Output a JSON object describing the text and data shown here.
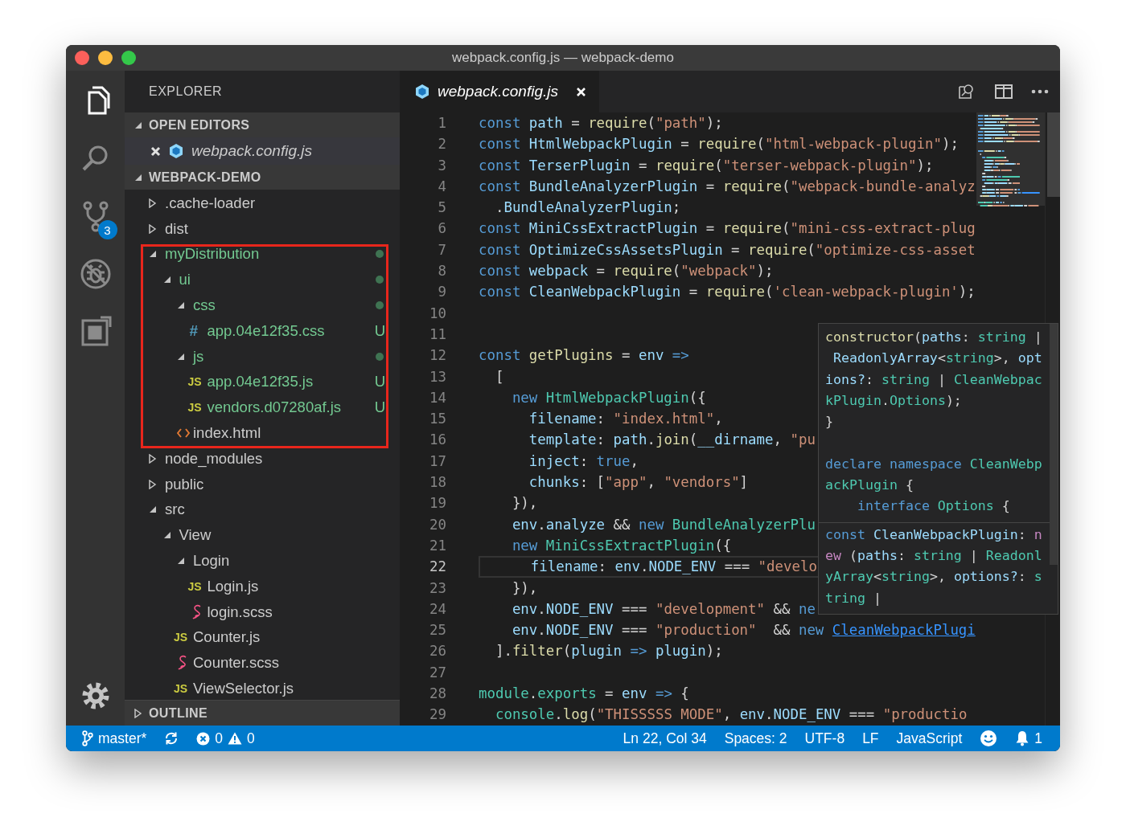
{
  "window": {
    "title": "webpack.config.js — webpack-demo"
  },
  "activity_bar": {
    "items": [
      {
        "kind": "explorer",
        "selected": true
      },
      {
        "kind": "search",
        "selected": false
      },
      {
        "kind": "source_control",
        "selected": false,
        "badge": "3"
      },
      {
        "kind": "debug",
        "selected": false
      },
      {
        "kind": "extensions",
        "selected": false
      }
    ]
  },
  "sidebar": {
    "title": "EXPLORER",
    "open_editors": {
      "title": "OPEN EDITORS",
      "expanded": true,
      "items": [
        {
          "name": "webpack.config.js",
          "selected": true
        }
      ]
    },
    "project": {
      "title": "WEBPACK-DEMO",
      "expanded": true,
      "tree": [
        {
          "name": ".cache-loader",
          "kind": "folder",
          "expanded": false,
          "untracked": false,
          "annotated": false
        },
        {
          "name": "dist",
          "kind": "folder",
          "expanded": false,
          "untracked": false,
          "annotated": false
        },
        {
          "name": "myDistribution",
          "kind": "folder",
          "expanded": true,
          "untracked": true,
          "annotated": true,
          "children": [
            {
              "name": "ui",
              "kind": "folder",
              "expanded": true,
              "untracked": true,
              "children": [
                {
                  "name": "css",
                  "kind": "folder",
                  "expanded": true,
                  "untracked": true,
                  "children": [
                    {
                      "name": "app.04e12f35.css",
                      "kind": "css",
                      "glyph": "#",
                      "untracked": true,
                      "badge": "U"
                    }
                  ]
                },
                {
                  "name": "js",
                  "kind": "folder",
                  "expanded": true,
                  "untracked": true,
                  "children": [
                    {
                      "name": "app.04e12f35.js",
                      "kind": "js",
                      "glyph": "JS",
                      "untracked": true,
                      "badge": "U"
                    },
                    {
                      "name": "vendors.d07280af.js",
                      "kind": "js",
                      "glyph": "JS",
                      "untracked": true,
                      "badge": "U"
                    }
                  ]
                },
                {
                  "name": "index.html",
                  "kind": "html",
                  "untracked": false
                }
              ]
            }
          ]
        },
        {
          "name": "node_modules",
          "kind": "folder",
          "expanded": false,
          "untracked": false,
          "annotated": false
        },
        {
          "name": "public",
          "kind": "folder",
          "expanded": false,
          "untracked": false,
          "annotated": false
        },
        {
          "name": "src",
          "kind": "folder",
          "expanded": true,
          "untracked": false,
          "annotated": false,
          "children": [
            {
              "name": "View",
              "kind": "folder",
              "expanded": true,
              "untracked": false,
              "children": [
                {
                  "name": "Login",
                  "kind": "folder",
                  "expanded": true,
                  "untracked": false,
                  "children": [
                    {
                      "name": "Login.js",
                      "kind": "js",
                      "glyph": "JS",
                      "untracked": false
                    },
                    {
                      "name": "login.scss",
                      "kind": "scss",
                      "untracked": false
                    }
                  ]
                },
                {
                  "name": "Counter.js",
                  "kind": "js",
                  "glyph": "JS",
                  "untracked": false
                },
                {
                  "name": "Counter.scss",
                  "kind": "scss",
                  "untracked": false
                },
                {
                  "name": "ViewSelector.js",
                  "kind": "js",
                  "glyph": "JS",
                  "untracked": false
                }
              ]
            }
          ]
        }
      ]
    },
    "outline": {
      "title": "OUTLINE",
      "expanded": false
    }
  },
  "editor": {
    "tabs": [
      {
        "label": "webpack.config.js",
        "selected": true
      }
    ],
    "lines": [
      {
        "number": "1",
        "current": false,
        "tokens": [
          {
            "kind": "keyword",
            "text": "const"
          },
          {
            "kind": "variable",
            "text": " path"
          },
          {
            "kind": "plain",
            "text": " = "
          },
          {
            "kind": "function",
            "text": "require"
          },
          {
            "kind": "plain",
            "text": "("
          },
          {
            "kind": "string",
            "text": "\"path\""
          },
          {
            "kind": "plain",
            "text": ");"
          }
        ]
      },
      {
        "number": "2",
        "current": false,
        "tokens": [
          {
            "kind": "keyword",
            "text": "const"
          },
          {
            "kind": "variable",
            "text": " HtmlWebpackPlugin"
          },
          {
            "kind": "plain",
            "text": " = "
          },
          {
            "kind": "function",
            "text": "require"
          },
          {
            "kind": "plain",
            "text": "("
          },
          {
            "kind": "string",
            "text": "\"html-webpack-plugin\""
          },
          {
            "kind": "plain",
            "text": ");"
          }
        ]
      },
      {
        "number": "3",
        "current": false,
        "tokens": [
          {
            "kind": "keyword",
            "text": "const"
          },
          {
            "kind": "variable",
            "text": " TerserPlugin"
          },
          {
            "kind": "plain",
            "text": " = "
          },
          {
            "kind": "function",
            "text": "require"
          },
          {
            "kind": "plain",
            "text": "("
          },
          {
            "kind": "string",
            "text": "\"terser-webpack-plugin\""
          },
          {
            "kind": "plain",
            "text": ");"
          }
        ]
      },
      {
        "number": "4",
        "current": false,
        "tokens": [
          {
            "kind": "keyword",
            "text": "const"
          },
          {
            "kind": "variable",
            "text": " BundleAnalyzerPlugin"
          },
          {
            "kind": "plain",
            "text": " = "
          },
          {
            "kind": "function",
            "text": "require"
          },
          {
            "kind": "plain",
            "text": "("
          },
          {
            "kind": "string",
            "text": "\"webpack-bundle-analyz"
          }
        ]
      },
      {
        "number": "5",
        "current": false,
        "tokens": [
          {
            "kind": "plain",
            "text": "  ."
          },
          {
            "kind": "variable",
            "text": "BundleAnalyzerPlugin"
          },
          {
            "kind": "plain",
            "text": ";"
          }
        ]
      },
      {
        "number": "6",
        "current": false,
        "tokens": [
          {
            "kind": "keyword",
            "text": "const"
          },
          {
            "kind": "variable",
            "text": " MiniCssExtractPlugin"
          },
          {
            "kind": "plain",
            "text": " = "
          },
          {
            "kind": "function",
            "text": "require"
          },
          {
            "kind": "plain",
            "text": "("
          },
          {
            "kind": "string",
            "text": "\"mini-css-extract-plug"
          }
        ]
      },
      {
        "number": "7",
        "current": false,
        "tokens": [
          {
            "kind": "keyword",
            "text": "const"
          },
          {
            "kind": "variable",
            "text": " OptimizeCssAssetsPlugin"
          },
          {
            "kind": "plain",
            "text": " = "
          },
          {
            "kind": "function",
            "text": "require"
          },
          {
            "kind": "plain",
            "text": "("
          },
          {
            "kind": "string",
            "text": "\"optimize-css-asset"
          }
        ]
      },
      {
        "number": "8",
        "current": false,
        "tokens": [
          {
            "kind": "keyword",
            "text": "const"
          },
          {
            "kind": "variable",
            "text": " webpack"
          },
          {
            "kind": "plain",
            "text": " = "
          },
          {
            "kind": "function",
            "text": "require"
          },
          {
            "kind": "plain",
            "text": "("
          },
          {
            "kind": "string",
            "text": "\"webpack\""
          },
          {
            "kind": "plain",
            "text": ");"
          }
        ]
      },
      {
        "number": "9",
        "current": false,
        "tokens": [
          {
            "kind": "keyword",
            "text": "const"
          },
          {
            "kind": "variable",
            "text": " CleanWebpackPlugin"
          },
          {
            "kind": "plain",
            "text": " = "
          },
          {
            "kind": "function",
            "text": "require"
          },
          {
            "kind": "plain",
            "text": "("
          },
          {
            "kind": "string",
            "text": "'clean-webpack-plugin'"
          },
          {
            "kind": "plain",
            "text": ");"
          }
        ]
      },
      {
        "number": "10",
        "current": false
      },
      {
        "number": "11",
        "current": false
      },
      {
        "number": "12",
        "current": false,
        "tokens": [
          {
            "kind": "keyword",
            "text": "const"
          },
          {
            "kind": "function",
            "text": " getPlugins"
          },
          {
            "kind": "plain",
            "text": " = "
          },
          {
            "kind": "variable",
            "text": "env"
          },
          {
            "kind": "keyword",
            "text": " =>"
          }
        ]
      },
      {
        "number": "13",
        "current": false,
        "tokens": [
          {
            "kind": "plain",
            "text": "  ["
          }
        ]
      },
      {
        "number": "14",
        "current": false,
        "tokens": [
          {
            "kind": "keyword",
            "text": "    new"
          },
          {
            "kind": "class",
            "text": " HtmlWebpackPlugin"
          },
          {
            "kind": "plain",
            "text": "({"
          }
        ]
      },
      {
        "number": "15",
        "current": false,
        "tokens": [
          {
            "kind": "variable",
            "text": "      filename"
          },
          {
            "kind": "plain",
            "text": ": "
          },
          {
            "kind": "string",
            "text": "\"index.html\""
          },
          {
            "kind": "plain",
            "text": ","
          }
        ]
      },
      {
        "number": "16",
        "current": false,
        "tokens": [
          {
            "kind": "variable",
            "text": "      template"
          },
          {
            "kind": "plain",
            "text": ": "
          },
          {
            "kind": "variable",
            "text": "path"
          },
          {
            "kind": "plain",
            "text": "."
          },
          {
            "kind": "function",
            "text": "join"
          },
          {
            "kind": "plain",
            "text": "("
          },
          {
            "kind": "variable",
            "text": "__dirname"
          },
          {
            "kind": "plain",
            "text": ", "
          },
          {
            "kind": "string",
            "text": "\"pu"
          }
        ]
      },
      {
        "number": "17",
        "current": false,
        "tokens": [
          {
            "kind": "variable",
            "text": "      inject"
          },
          {
            "kind": "plain",
            "text": ": "
          },
          {
            "kind": "keyword",
            "text": "true"
          },
          {
            "kind": "plain",
            "text": ","
          }
        ]
      },
      {
        "number": "18",
        "current": false,
        "tokens": [
          {
            "kind": "variable",
            "text": "      chunks"
          },
          {
            "kind": "plain",
            "text": ": ["
          },
          {
            "kind": "string",
            "text": "\"app\""
          },
          {
            "kind": "plain",
            "text": ", "
          },
          {
            "kind": "string",
            "text": "\"vendors\""
          },
          {
            "kind": "plain",
            "text": "]"
          }
        ]
      },
      {
        "number": "19",
        "current": false,
        "tokens": [
          {
            "kind": "plain",
            "text": "    }),"
          }
        ]
      },
      {
        "number": "20",
        "current": false,
        "tokens": [
          {
            "kind": "variable",
            "text": "    env"
          },
          {
            "kind": "plain",
            "text": "."
          },
          {
            "kind": "variable",
            "text": "analyze"
          },
          {
            "kind": "plain",
            "text": " && "
          },
          {
            "kind": "keyword",
            "text": "new"
          },
          {
            "kind": "class",
            "text": " BundleAnalyzerPlu"
          }
        ]
      },
      {
        "number": "21",
        "current": false,
        "tokens": [
          {
            "kind": "keyword",
            "text": "    new"
          },
          {
            "kind": "class",
            "text": " MiniCssExtractPlugin"
          },
          {
            "kind": "plain",
            "text": "({"
          }
        ]
      },
      {
        "number": "22",
        "current": true,
        "tokens": [
          {
            "kind": "variable",
            "text": "      filename"
          },
          {
            "kind": "plain",
            "text": ": "
          },
          {
            "kind": "variable",
            "text": "env"
          },
          {
            "kind": "plain",
            "text": "."
          },
          {
            "kind": "variable",
            "text": "NODE_ENV"
          },
          {
            "kind": "plain",
            "text": " === "
          },
          {
            "kind": "string",
            "text": "\"develo"
          }
        ]
      },
      {
        "number": "23",
        "current": false,
        "tokens": [
          {
            "kind": "plain",
            "text": "    }),"
          }
        ]
      },
      {
        "number": "24",
        "current": false,
        "tokens": [
          {
            "kind": "variable",
            "text": "    env"
          },
          {
            "kind": "plain",
            "text": "."
          },
          {
            "kind": "variable",
            "text": "NODE_ENV"
          },
          {
            "kind": "plain",
            "text": " === "
          },
          {
            "kind": "string",
            "text": "\"development\""
          },
          {
            "kind": "plain",
            "text": " && "
          },
          {
            "kind": "keyword",
            "text": "ne"
          }
        ]
      },
      {
        "number": "25",
        "current": false,
        "tokens": [
          {
            "kind": "variable",
            "text": "    env"
          },
          {
            "kind": "plain",
            "text": "."
          },
          {
            "kind": "variable",
            "text": "NODE_ENV"
          },
          {
            "kind": "plain",
            "text": " === "
          },
          {
            "kind": "string",
            "text": "\"production\""
          },
          {
            "kind": "plain",
            "text": "  && "
          },
          {
            "kind": "keyword",
            "text": "new "
          },
          {
            "kind": "link",
            "text": "CleanWebpackPlugi"
          }
        ]
      },
      {
        "number": "26",
        "current": false,
        "tokens": [
          {
            "kind": "plain",
            "text": "  ]."
          },
          {
            "kind": "function",
            "text": "filter"
          },
          {
            "kind": "plain",
            "text": "("
          },
          {
            "kind": "variable",
            "text": "plugin"
          },
          {
            "kind": "keyword",
            "text": " =>"
          },
          {
            "kind": "variable",
            "text": " plugin"
          },
          {
            "kind": "plain",
            "text": ");"
          }
        ]
      },
      {
        "number": "27",
        "current": false
      },
      {
        "number": "28",
        "current": false,
        "tokens": [
          {
            "kind": "class",
            "text": "module"
          },
          {
            "kind": "plain",
            "text": "."
          },
          {
            "kind": "class",
            "text": "exports"
          },
          {
            "kind": "plain",
            "text": " = "
          },
          {
            "kind": "variable",
            "text": "env"
          },
          {
            "kind": "keyword",
            "text": " =>"
          },
          {
            "kind": "plain",
            "text": " {"
          }
        ]
      },
      {
        "number": "29",
        "current": false,
        "tokens": [
          {
            "kind": "class",
            "text": "  console"
          },
          {
            "kind": "plain",
            "text": "."
          },
          {
            "kind": "function",
            "text": "log"
          },
          {
            "kind": "plain",
            "text": "("
          },
          {
            "kind": "string",
            "text": "\"THISSSSS MODE\""
          },
          {
            "kind": "plain",
            "text": ", "
          },
          {
            "kind": "variable",
            "text": "env"
          },
          {
            "kind": "plain",
            "text": "."
          },
          {
            "kind": "variable",
            "text": "NODE_ENV"
          },
          {
            "kind": "plain",
            "text": " === "
          },
          {
            "kind": "string",
            "text": "\"productio"
          }
        ]
      }
    ],
    "hover": {
      "sections": [
        {
          "divider": false,
          "lines": [
            [
              {
                "kind": "function",
                "text": "constructor"
              },
              {
                "kind": "plain",
                "text": "("
              },
              {
                "kind": "variable",
                "text": "paths"
              },
              {
                "kind": "plain",
                "text": ": "
              },
              {
                "kind": "class",
                "text": "string"
              },
              {
                "kind": "plain",
                "text": " |"
              }
            ],
            [
              {
                "kind": "variable",
                "text": " ReadonlyArray"
              },
              {
                "kind": "plain",
                "text": "<"
              },
              {
                "kind": "class",
                "text": "string"
              },
              {
                "kind": "plain",
                "text": ">, "
              },
              {
                "kind": "variable",
                "text": "opt"
              }
            ],
            [
              {
                "kind": "variable",
                "text": "ions?"
              },
              {
                "kind": "plain",
                "text": ": "
              },
              {
                "kind": "class",
                "text": "string"
              },
              {
                "kind": "plain",
                "text": " | "
              },
              {
                "kind": "class",
                "text": "CleanWebpac"
              }
            ],
            [
              {
                "kind": "class",
                "text": "kPlugin"
              },
              {
                "kind": "plain",
                "text": "."
              },
              {
                "kind": "class",
                "text": "Options"
              },
              {
                "kind": "plain",
                "text": ");"
              }
            ],
            [
              {
                "kind": "plain",
                "text": "}"
              }
            ]
          ]
        },
        {
          "divider": false,
          "lines": [
            [
              {
                "kind": "keyword",
                "text": "declare"
              },
              {
                "kind": "keyword",
                "text": " namespace"
              },
              {
                "kind": "class",
                "text": " CleanWebp"
              }
            ],
            [
              {
                "kind": "class",
                "text": "ackPlugin"
              },
              {
                "kind": "plain",
                "text": " {"
              }
            ],
            [
              {
                "kind": "keyword",
                "text": "    interface"
              },
              {
                "kind": "class",
                "text": " Options"
              },
              {
                "kind": "plain",
                "text": " {"
              }
            ]
          ]
        },
        {
          "divider": true,
          "lines": [
            [
              {
                "kind": "keyword",
                "text": "const"
              },
              {
                "kind": "variable",
                "text": " CleanWebpackPlugin"
              },
              {
                "kind": "plain",
                "text": ": "
              },
              {
                "kind": "control",
                "text": "n"
              }
            ],
            [
              {
                "kind": "control",
                "text": "ew"
              },
              {
                "kind": "plain",
                "text": " ("
              },
              {
                "kind": "variable",
                "text": "paths"
              },
              {
                "kind": "plain",
                "text": ": "
              },
              {
                "kind": "class",
                "text": "string"
              },
              {
                "kind": "plain",
                "text": " | "
              },
              {
                "kind": "class",
                "text": "Readonl"
              }
            ],
            [
              {
                "kind": "class",
                "text": "yArray"
              },
              {
                "kind": "plain",
                "text": "<"
              },
              {
                "kind": "class",
                "text": "string"
              },
              {
                "kind": "plain",
                "text": ">, "
              },
              {
                "kind": "variable",
                "text": "options?"
              },
              {
                "kind": "plain",
                "text": ": "
              },
              {
                "kind": "class",
                "text": "s"
              }
            ],
            [
              {
                "kind": "class",
                "text": "tring"
              },
              {
                "kind": "plain",
                "text": " |"
              }
            ]
          ]
        }
      ]
    }
  },
  "status_bar": {
    "left": [
      {
        "kind": "branch",
        "text": "master*"
      },
      {
        "kind": "sync"
      },
      {
        "kind": "problems",
        "errors": "0",
        "warnings": "0"
      }
    ],
    "right": [
      {
        "kind": "text",
        "text": "Ln 22, Col 34"
      },
      {
        "kind": "text",
        "text": "Spaces: 2"
      },
      {
        "kind": "text",
        "text": "UTF-8"
      },
      {
        "kind": "text",
        "text": "LF"
      },
      {
        "kind": "text",
        "text": "JavaScript"
      },
      {
        "kind": "feedback"
      },
      {
        "kind": "notifications",
        "text": "1"
      }
    ]
  }
}
